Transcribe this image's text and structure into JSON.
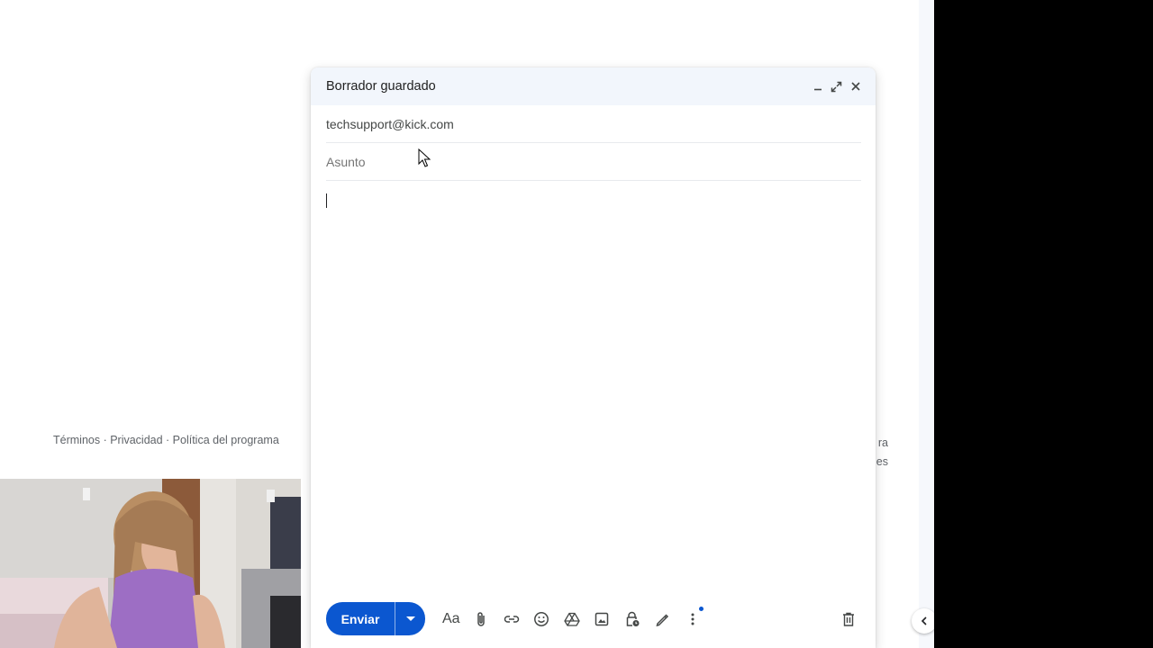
{
  "footer": {
    "links": "Términos · Privacidad · Política del programa",
    "right_fragment_1": "ra",
    "right_fragment_2": "es"
  },
  "compose": {
    "title": "Borrador guardado",
    "to_value": "techsupport@kick.com",
    "subject_placeholder": "Asunto",
    "subject_value": "",
    "body_value": "",
    "send_label": "Enviar",
    "formatting_label": "Aa"
  },
  "icons": {
    "minimize": "minimize-icon",
    "popout": "expand-icon",
    "close": "close-icon",
    "send_options": "caret-down-icon",
    "attach": "paperclip-icon",
    "link": "link-icon",
    "emoji": "emoji-icon",
    "drive": "drive-icon",
    "photo": "image-icon",
    "confidential": "lock-clock-icon",
    "signature": "pen-icon",
    "more": "more-vert-icon",
    "discard": "trash-icon",
    "side_panel": "chevron-left-icon"
  },
  "colors": {
    "accent": "#0b57d0",
    "header_bg": "#f2f6fc",
    "text_muted": "#5f6368"
  }
}
